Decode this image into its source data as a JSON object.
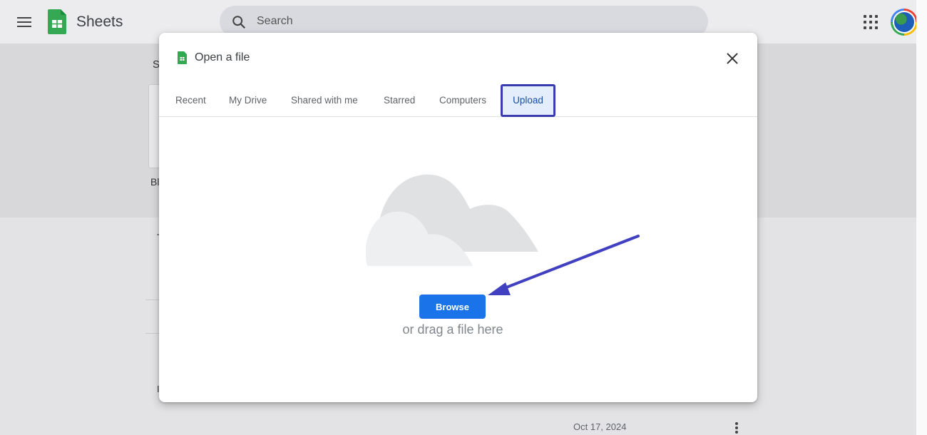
{
  "app": {
    "name": "Sheets",
    "search_placeholder": "Search"
  },
  "background": {
    "templates_heading_fragment": "S",
    "template_label_fragment": "Bl",
    "recent_fragment_1": "T",
    "recent_fragment_2": "I",
    "row_date": "Oct 17, 2024"
  },
  "dialog": {
    "title": "Open a file",
    "tabs": [
      {
        "label": "Recent",
        "active": false
      },
      {
        "label": "My Drive",
        "active": false
      },
      {
        "label": "Shared with me",
        "active": false
      },
      {
        "label": "Starred",
        "active": false
      },
      {
        "label": "Computers",
        "active": false
      },
      {
        "label": "Upload",
        "active": true
      }
    ],
    "browse_label": "Browse",
    "drag_text": "or drag a file here"
  },
  "colors": {
    "accent": "#1a73e8",
    "highlight_border": "#3b3bb0",
    "annotation_arrow": "#4040c0",
    "sheets_green": "#34a853"
  }
}
